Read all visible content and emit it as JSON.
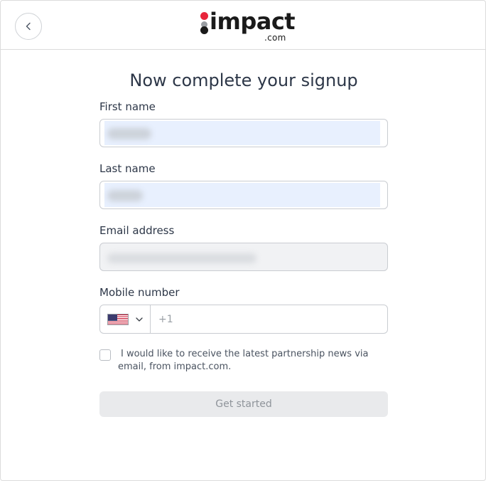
{
  "header": {
    "back_icon": "chevron-left-icon",
    "logo": {
      "word": "impact",
      "tld": ".com",
      "dot_colors": {
        "red": "#e8253b",
        "grey": "#9a9ea3",
        "black": "#1a1a1a"
      }
    }
  },
  "form": {
    "title": "Now complete your signup",
    "first_name": {
      "label": "First name",
      "value_state": "autofilled (obscured)"
    },
    "last_name": {
      "label": "Last name",
      "value_state": "autofilled (obscured)"
    },
    "email": {
      "label": "Email address",
      "value_state": "prefilled read-only (obscured)"
    },
    "mobile": {
      "label": "Mobile number",
      "country_flag_icon": "us-flag-icon",
      "placeholder": "+1"
    },
    "consent": {
      "checked": false,
      "text": "I would like to receive the latest partnership news via email, from impact.com."
    },
    "submit": {
      "label": "Get started",
      "disabled": true
    }
  },
  "colors": {
    "autofill_bg": "#e8f0fe",
    "disabled_bg": "#f1f2f4",
    "button_bg": "#e9eaec",
    "button_text": "#8f949a",
    "border": "#c9ccd1",
    "text": "#2d3748"
  }
}
